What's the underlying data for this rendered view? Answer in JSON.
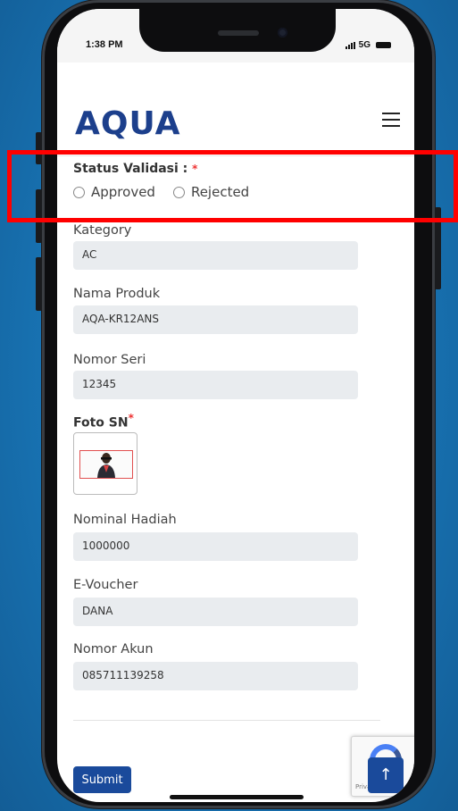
{
  "status_bar": {
    "time": "1:38 PM",
    "network": "5G"
  },
  "header": {
    "brand": "AQUA",
    "menu_icon": "hamburger-icon"
  },
  "form": {
    "status_validasi": {
      "label": "Status Validasi :",
      "required": "*",
      "options": [
        "Approved",
        "Rejected"
      ]
    },
    "kategori": {
      "label": "Kategory",
      "value": "AC"
    },
    "nama_produk": {
      "label": "Nama Produk",
      "value": "AQA-KR12ANS"
    },
    "nomor_seri": {
      "label": "Nomor Seri",
      "value": "12345"
    },
    "foto_sn": {
      "label": "Foto SN",
      "required": "*"
    },
    "nominal_hadiah": {
      "label": "Nominal Hadiah",
      "value": "1000000"
    },
    "e_voucher": {
      "label": "E-Voucher",
      "value": "DANA"
    },
    "nomor_akun": {
      "label": "Nomor Akun",
      "value": "085711139258"
    }
  },
  "actions": {
    "submit_label": "Submit",
    "scroll_top_icon": "↑"
  },
  "recaptcha": {
    "text": "Privacy - Terms"
  },
  "colors": {
    "primary": "#1a4a9b",
    "brand": "#1c3f8c",
    "highlight": "#ff0000",
    "background": "#1873b3"
  }
}
